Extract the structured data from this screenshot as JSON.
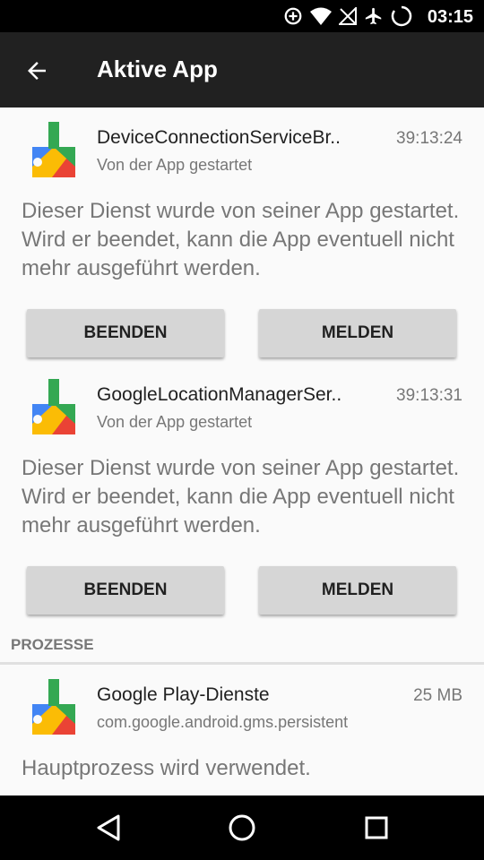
{
  "status_bar": {
    "time": "03:15",
    "icons": [
      "data-saver-icon",
      "wifi-icon",
      "no-sim-icon",
      "airplane-icon",
      "battery-charging-icon"
    ]
  },
  "app_bar": {
    "title": "Aktive App",
    "back_icon": "arrow-back-icon"
  },
  "services": [
    {
      "name": "DeviceConnectionServiceBr..",
      "time": "39:13:24",
      "subtitle": "Von der App gestartet",
      "description": "Dieser Dienst wurde von seiner App gestartet. Wird er beendet, kann die App eventuell nicht mehr ausgeführt werden.",
      "stop_label": "BEENDEN",
      "report_label": "MELDEN"
    },
    {
      "name": "GoogleLocationManagerSer..",
      "time": "39:13:31",
      "subtitle": "Von der App gestartet",
      "description": "Dieser Dienst wurde von seiner App gestartet. Wird er beendet, kann die App eventuell nicht mehr ausgeführt werden.",
      "stop_label": "BEENDEN",
      "report_label": "MELDEN"
    }
  ],
  "processes": {
    "header": "PROZESSE",
    "items": [
      {
        "name": "Google Play-Dienste",
        "size": "25 MB",
        "package": "com.google.android.gms.persistent",
        "description": "Hauptprozess wird verwendet."
      }
    ]
  },
  "nav_bar": {
    "icons": [
      "back-triangle-icon",
      "home-circle-icon",
      "recents-square-icon"
    ]
  }
}
